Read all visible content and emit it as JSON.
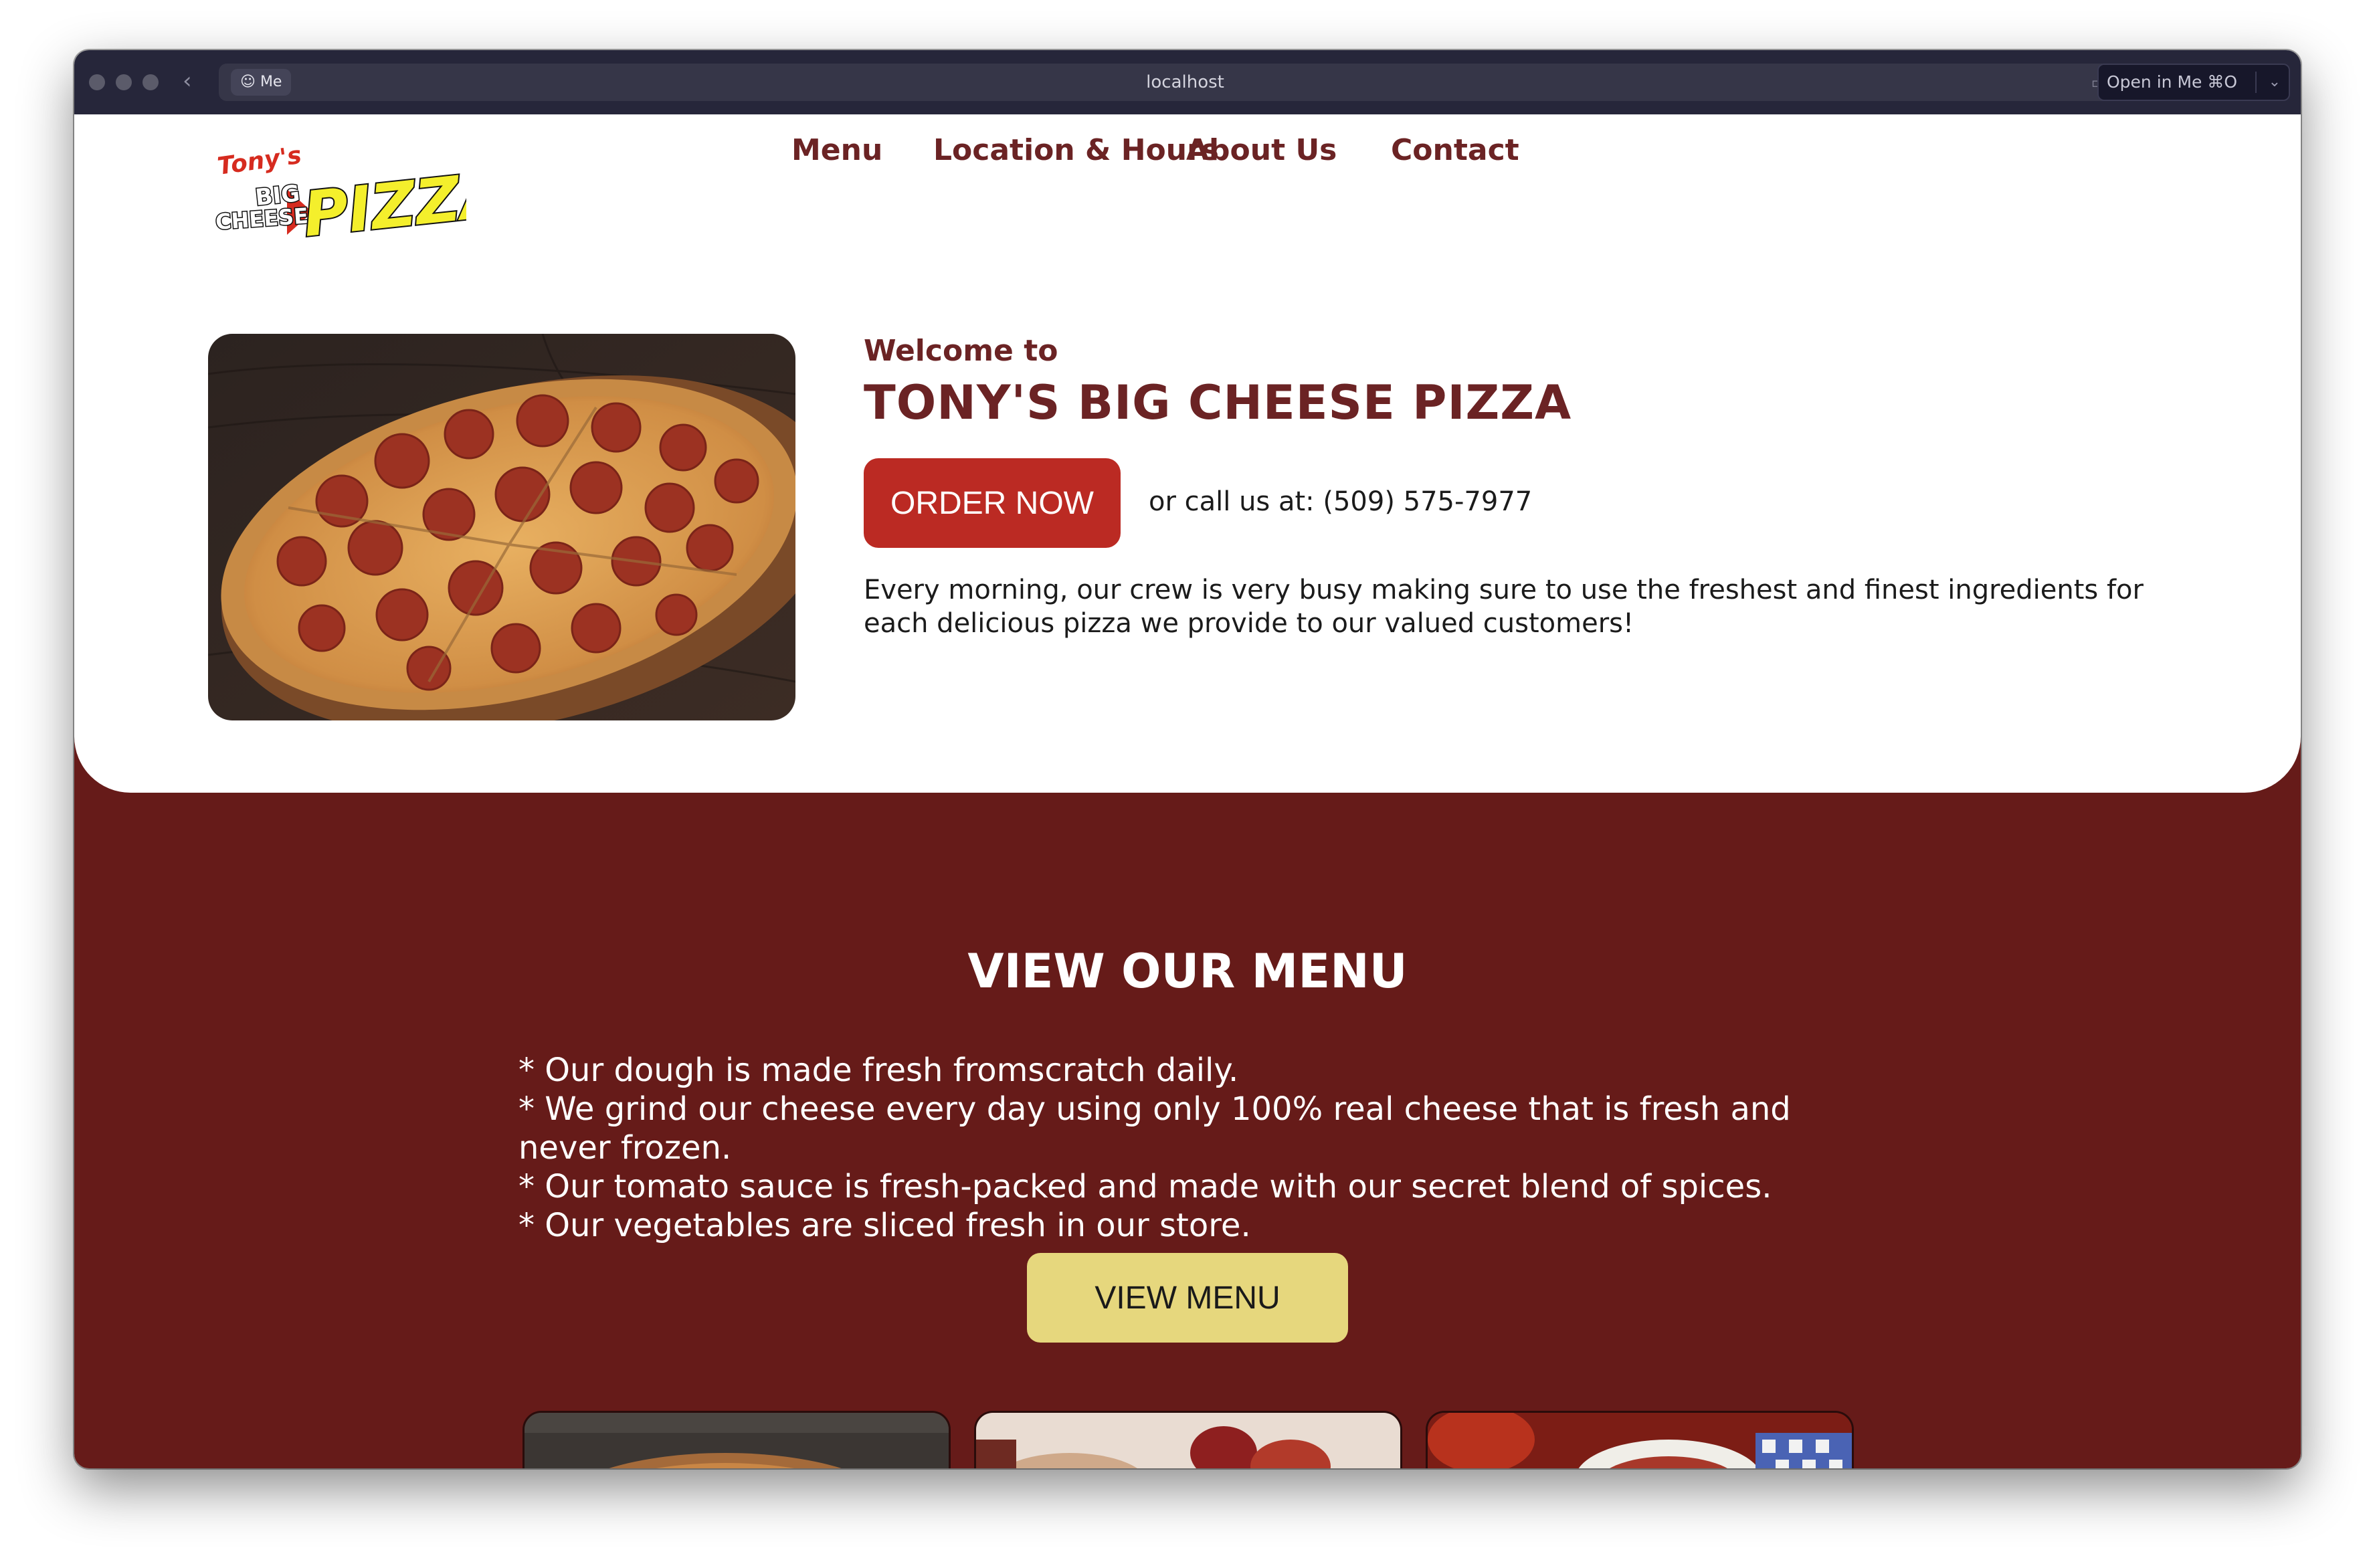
{
  "browser": {
    "profile_label": "Me",
    "url": "localhost",
    "open_in_label": "Open in Me  ⌘O"
  },
  "nav": {
    "items": [
      {
        "label": "Menu"
      },
      {
        "label": "Location & Hours"
      },
      {
        "label": "About Us"
      },
      {
        "label": "Contact"
      }
    ]
  },
  "logo": {
    "text_tonys": "Tony's",
    "text_big": "BIG",
    "text_cheese": "CHEESE",
    "text_pizza": "PIZZA"
  },
  "hero": {
    "welcome": "Welcome to",
    "headline": "TONY'S BIG CHEESE PIZZA",
    "order_button": "ORDER NOW",
    "call_text": "or call us at: (509) 575-7977",
    "intro": "Every morning, our crew is very busy making sure to use the freshest and finest ingredients for each delicious pizza we provide to our valued customers!"
  },
  "menu_section": {
    "title": "VIEW OUR MENU",
    "bullets": [
      "* Our dough is made fresh fromscratch daily.",
      "* We grind our cheese every day using only 100% real cheese that is fresh and never frozen.",
      "* Our tomato sauce is fresh-packed and made with our secret blend of spices.",
      "* Our vegetables are sliced fresh in our store."
    ],
    "view_button": "VIEW MENU"
  },
  "colors": {
    "brand_maroon": "#661b19",
    "order_red": "#bb2a23",
    "menu_yellow": "#e6d77d",
    "text_maroon": "#6b2324"
  }
}
